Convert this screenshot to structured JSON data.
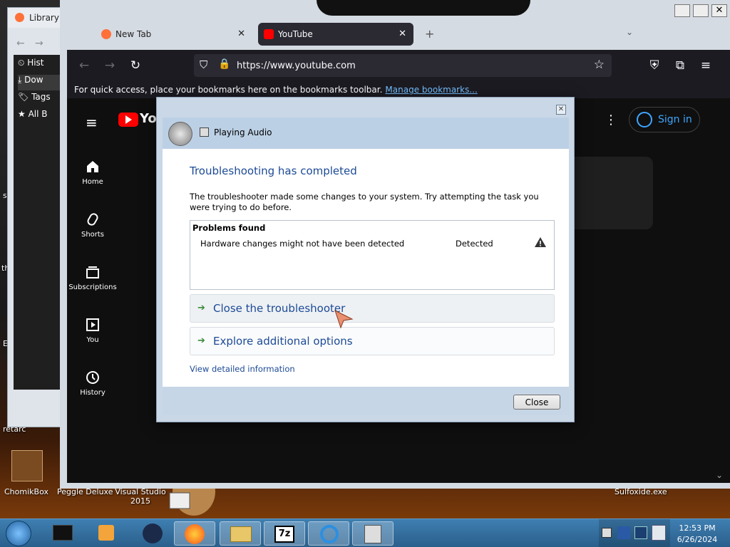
{
  "library": {
    "title": "Library",
    "items": [
      "Hist",
      "Dow",
      "Tags",
      "All B"
    ]
  },
  "browser": {
    "tabs": [
      {
        "label": "New Tab"
      },
      {
        "label": "YouTube"
      }
    ],
    "url": "https://www.youtube.com",
    "bookmarks_message": "For quick access, place your bookmarks here on the bookmarks toolbar.",
    "bookmarks_link": "Manage bookmarks..."
  },
  "youtube": {
    "logo_text": "You",
    "nav": [
      "Home",
      "Shorts",
      "Subscriptions",
      "You",
      "History"
    ],
    "sign_in": "Sign in"
  },
  "dialog": {
    "app_title": "Playing Audio",
    "heading": "Troubleshooting has completed",
    "description": "The troubleshooter made some changes to your system. Try attempting the task you were trying to do before.",
    "problems_header": "Problems found",
    "problem": {
      "text": "Hardware changes might not have been detected",
      "status": "Detected"
    },
    "options": [
      "Close the troubleshooter",
      "Explore additional options"
    ],
    "details_link": "View detailed information",
    "close_button": "Close"
  },
  "desktop": {
    "icons": [
      {
        "label": "ChomikBox"
      },
      {
        "label": "Peggle Deluxe"
      },
      {
        "label": "Visual Studio 2015"
      },
      {
        "label": "Sulfoxide.exe"
      }
    ],
    "left_edge_text": [
      "s",
      "th",
      "E",
      "retarc"
    ]
  },
  "taskbar": {
    "time": "12:53 PM",
    "date": "6/26/2024"
  },
  "colors": {
    "accent": "#3ea6ff",
    "dialog_heading": "#1c4a96",
    "youtube_red": "#ff0000"
  }
}
